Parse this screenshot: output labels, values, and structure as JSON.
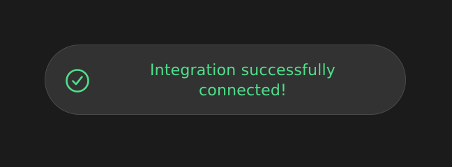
{
  "toast": {
    "message": "Integration successfully connected!",
    "icon": "check-circle-icon",
    "accent_color": "#4ee08a",
    "background_color": "#323232"
  }
}
